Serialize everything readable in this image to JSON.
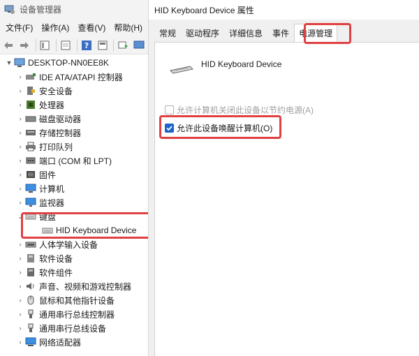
{
  "device_manager": {
    "title": "设备管理器",
    "menus": [
      "文件(F)",
      "操作(A)",
      "查看(V)",
      "帮助(H)"
    ],
    "toolbar_icons": [
      "back-icon",
      "forward-icon",
      "properties-icon",
      "refresh-icon",
      "help-icon",
      "details-icon",
      "scan-icon",
      "monitor-icon"
    ],
    "computer_name": "DESKTOP-NN0EE8K",
    "categories": [
      {
        "label": "IDE ATA/ATAPI 控制器",
        "icon": "ide-icon",
        "expanded": false
      },
      {
        "label": "安全设备",
        "icon": "security-device-icon",
        "expanded": false
      },
      {
        "label": "处理器",
        "icon": "processor-icon",
        "expanded": false
      },
      {
        "label": "磁盘驱动器",
        "icon": "disk-drive-icon",
        "expanded": false
      },
      {
        "label": "存储控制器",
        "icon": "storage-controller-icon",
        "expanded": false
      },
      {
        "label": "打印队列",
        "icon": "printer-icon",
        "expanded": false
      },
      {
        "label": "端口 (COM 和 LPT)",
        "icon": "port-icon",
        "expanded": false
      },
      {
        "label": "固件",
        "icon": "firmware-icon",
        "expanded": false
      },
      {
        "label": "计算机",
        "icon": "computer-icon",
        "expanded": false
      },
      {
        "label": "监视器",
        "icon": "monitor-icon",
        "expanded": false
      },
      {
        "label": "键盘",
        "icon": "keyboard-icon",
        "expanded": true,
        "children": [
          "HID Keyboard Device"
        ]
      },
      {
        "label": "人体学输入设备",
        "icon": "hid-icon",
        "expanded": false
      },
      {
        "label": "软件设备",
        "icon": "software-device-icon",
        "expanded": false
      },
      {
        "label": "软件组件",
        "icon": "software-component-icon",
        "expanded": false
      },
      {
        "label": "声音、视频和游戏控制器",
        "icon": "sound-icon",
        "expanded": false
      },
      {
        "label": "鼠标和其他指针设备",
        "icon": "mouse-icon",
        "expanded": false
      },
      {
        "label": "通用串行总线控制器",
        "icon": "usb-icon",
        "expanded": false
      },
      {
        "label": "通用串行总线设备",
        "icon": "usb-device-icon",
        "expanded": false
      },
      {
        "label": "网络适配器",
        "icon": "network-icon",
        "expanded": false
      }
    ]
  },
  "properties": {
    "title": "HID Keyboard Device 属性",
    "tabs": [
      "常规",
      "驱动程序",
      "详细信息",
      "事件",
      "电源管理"
    ],
    "active_tab": "电源管理",
    "device_name": "HID Keyboard Device",
    "options": [
      {
        "label": "允许计算机关闭此设备以节约电源(A)",
        "checked": false,
        "enabled": false
      },
      {
        "label": "允许此设备唤醒计算机(O)",
        "checked": true,
        "enabled": true
      }
    ]
  },
  "highlight_color": "#e04040",
  "accent_color": "#1e63c9"
}
